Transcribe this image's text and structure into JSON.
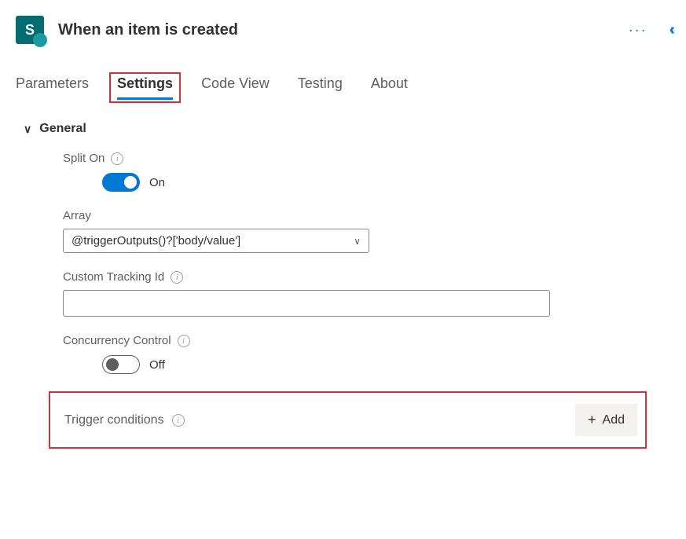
{
  "header": {
    "icon_letter": "S",
    "title": "When an item is created"
  },
  "tabs": {
    "items": [
      {
        "label": "Parameters",
        "active": false
      },
      {
        "label": "Settings",
        "active": true
      },
      {
        "label": "Code View",
        "active": false
      },
      {
        "label": "Testing",
        "active": false
      },
      {
        "label": "About",
        "active": false
      }
    ]
  },
  "section": {
    "title": "General",
    "split_on": {
      "label": "Split On",
      "state": "On",
      "on": true
    },
    "array": {
      "label": "Array",
      "value": "@triggerOutputs()?['body/value']"
    },
    "custom_tracking": {
      "label": "Custom Tracking Id",
      "value": ""
    },
    "concurrency": {
      "label": "Concurrency Control",
      "state": "Off",
      "on": false
    },
    "trigger_conditions": {
      "label": "Trigger conditions",
      "add_label": "Add"
    }
  }
}
